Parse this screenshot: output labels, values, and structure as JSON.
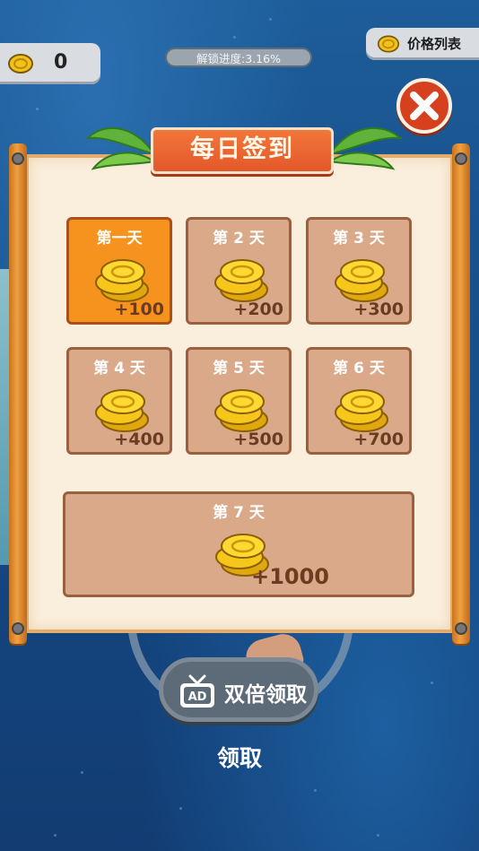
{
  "hud": {
    "coin_count": "0",
    "unlock_progress": "解锁进度:3.16%",
    "price_list_label": "价格列表"
  },
  "dialog": {
    "title": "每日签到",
    "days": [
      {
        "label": "第一天",
        "reward": "+100",
        "active": true
      },
      {
        "label": "第 2 天",
        "reward": "+200",
        "active": false
      },
      {
        "label": "第 3 天",
        "reward": "+300",
        "active": false
      },
      {
        "label": "第 4 天",
        "reward": "+400",
        "active": false
      },
      {
        "label": "第 5 天",
        "reward": "+500",
        "active": false
      },
      {
        "label": "第 6 天",
        "reward": "+700",
        "active": false
      },
      {
        "label": "第 7 天",
        "reward": "+1000",
        "active": false
      }
    ]
  },
  "buttons": {
    "ad_icon_text": "AD",
    "double_claim": "双倍领取",
    "claim": "领取"
  },
  "colors": {
    "active_day": "#f6921e",
    "inactive_day": "#d9a98a",
    "ribbon": "#e4582a",
    "close": "#d7401e"
  }
}
